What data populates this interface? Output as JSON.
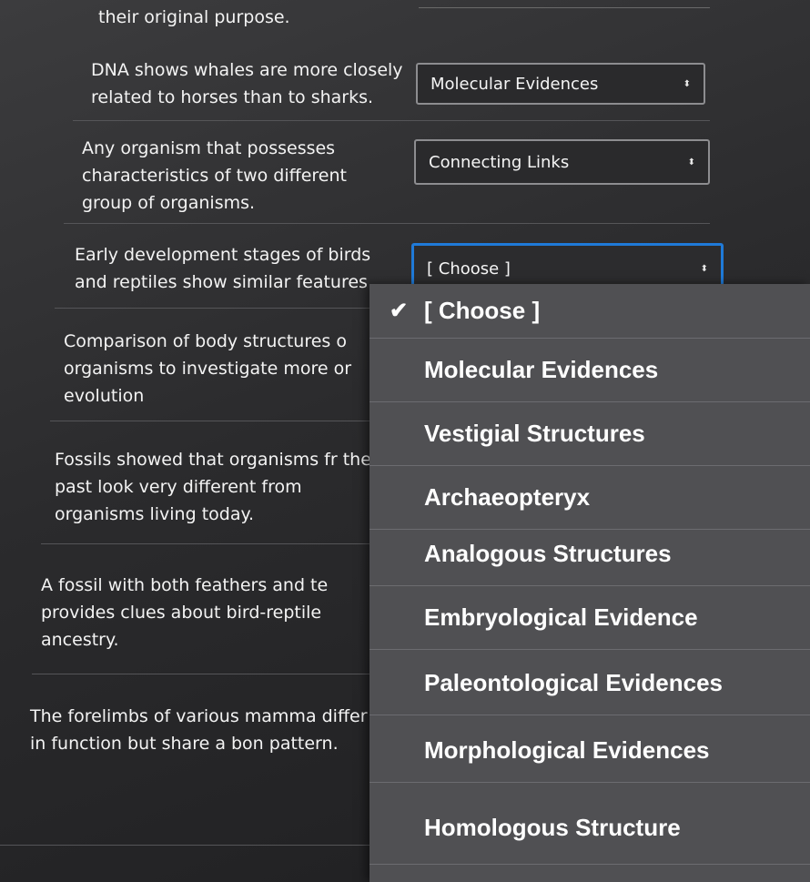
{
  "questions": [
    {
      "text": "their original purpose."
    },
    {
      "text": "DNA shows whales are more closely related to horses than to sharks.",
      "selected": "Molecular Evidences"
    },
    {
      "text": "Any organism that possesses characteristics of two different group of organisms.",
      "selected": "Connecting Links"
    },
    {
      "text": "Early development stages of birds and reptiles show similar features",
      "selected": "[ Choose ]"
    },
    {
      "text": "Comparison of body structures o organisms to investigate more or evolution"
    },
    {
      "text": "Fossils showed that organisms fr the past look very different from organisms living today."
    },
    {
      "text": "A fossil with both feathers and te provides clues about bird-reptile ancestry."
    },
    {
      "text": "The forelimbs of various mamma differ in function but share a bon pattern."
    }
  ],
  "dropdown": {
    "options": [
      "[ Choose ]",
      "Molecular Evidences",
      "Vestigial Structures",
      "Archaeopteryx",
      "Analogous Structures",
      "Embryological Evidence",
      "Paleontological Evidences",
      "Morphological Evidences",
      "Homologous Structure"
    ],
    "checked_index": 0,
    "check_glyph": "✔"
  },
  "icons": {
    "select_arrow": "⬍"
  },
  "colors": {
    "focus": "#1f7ad8",
    "dropdown_bg": "#505053",
    "page_bg": "#2b2b2d"
  }
}
